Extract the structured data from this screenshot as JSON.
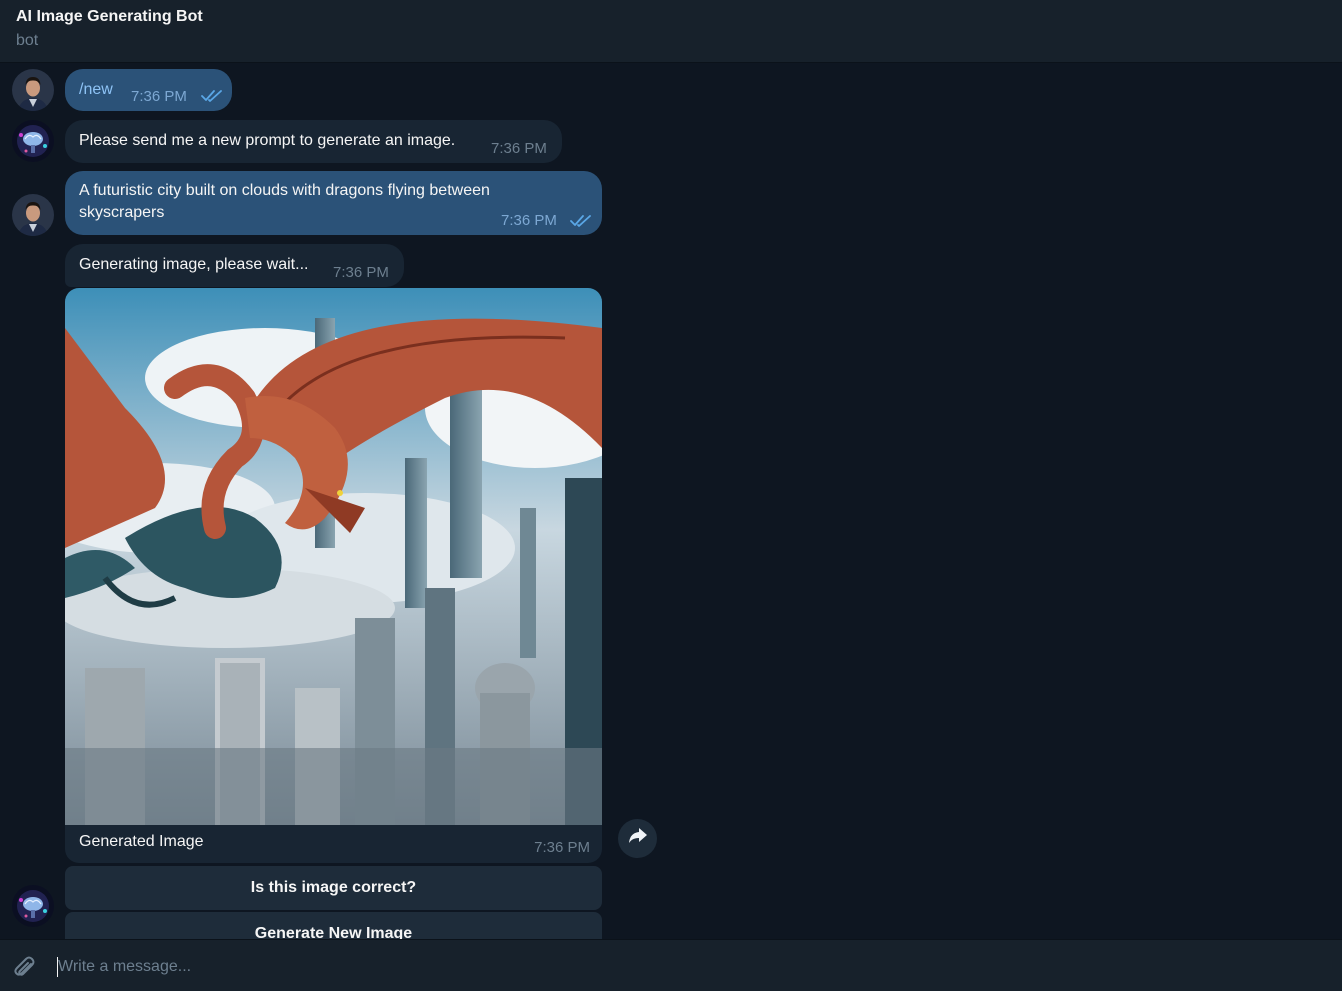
{
  "header": {
    "title": "AI Image Generating Bot",
    "subtitle": "bot"
  },
  "messages": [
    {
      "from": "user",
      "text": "/new",
      "time": "7:36 PM",
      "status": "read"
    },
    {
      "from": "bot",
      "text": "Please send me a new prompt to generate an image.",
      "time": "7:36 PM"
    },
    {
      "from": "user",
      "text": "A futuristic city built on clouds with dragons flying between skyscrapers",
      "time": "7:36 PM",
      "status": "read"
    },
    {
      "from": "bot",
      "text": "Generating image, please wait...",
      "time": "7:36 PM"
    },
    {
      "from": "bot",
      "type": "photo",
      "caption": "Generated Image",
      "time": "7:36 PM"
    }
  ],
  "inline_keyboard": [
    {
      "label": "Is this image correct?"
    },
    {
      "label": "Generate New Image"
    }
  ],
  "composer": {
    "placeholder": "Write a message..."
  },
  "colors": {
    "background": "#0e1621",
    "header": "#17212b",
    "outgoing_bubble": "#2b5278",
    "incoming_bubble": "#182533",
    "muted_text": "#6d7f8f",
    "read_check": "#5aa7e6"
  }
}
